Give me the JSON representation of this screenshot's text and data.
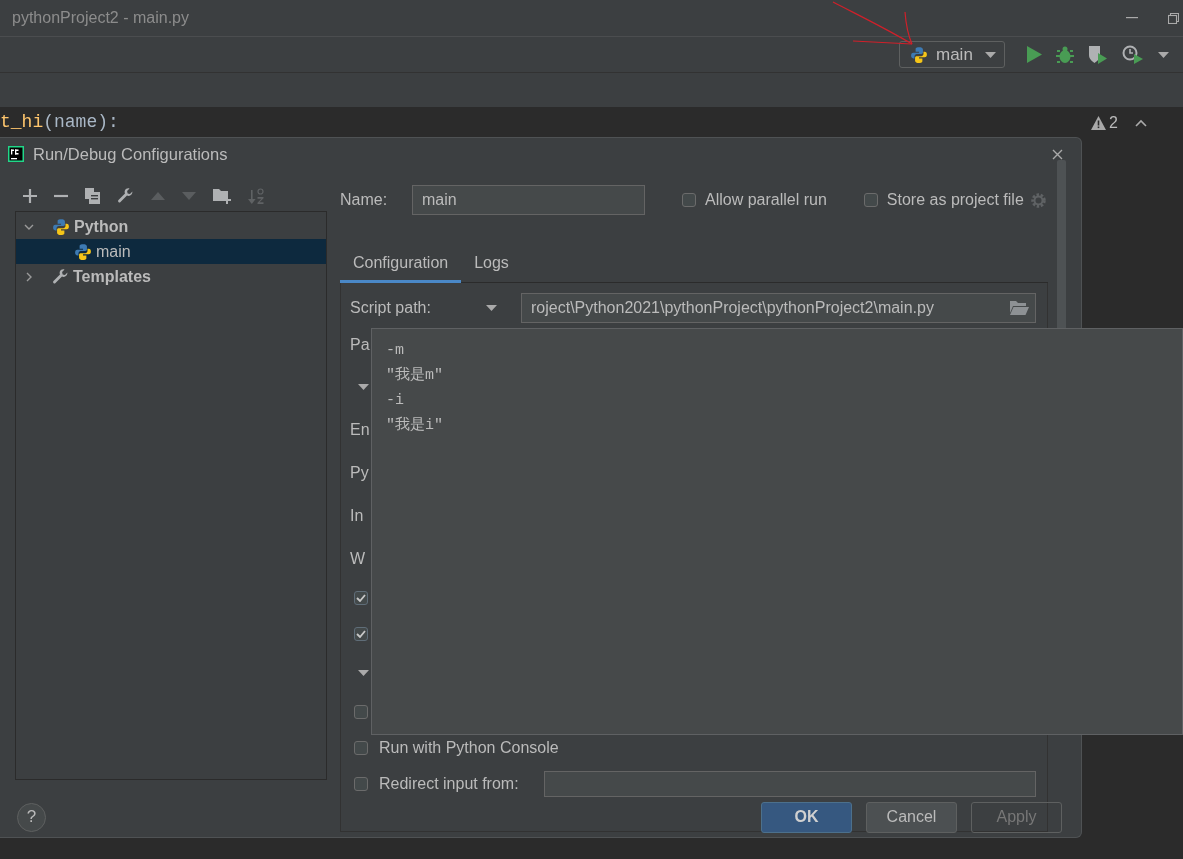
{
  "window": {
    "title": "pythonProject2 - main.py"
  },
  "toolbar": {
    "run_configuration": "main"
  },
  "editor": {
    "code_function": "t_hi",
    "code_rest": "(name):",
    "warning_count": "2"
  },
  "dialog": {
    "title": "Run/Debug Configurations",
    "tree": [
      {
        "label": "Python",
        "kind": "python",
        "expanded": true,
        "selected": false,
        "children": [
          {
            "label": "main",
            "kind": "python",
            "selected": true
          }
        ]
      },
      {
        "label": "Templates",
        "kind": "templates",
        "expanded": false,
        "selected": false
      }
    ],
    "name_field": {
      "label": "Name:",
      "value": "main"
    },
    "options": [
      {
        "label": "Allow parallel run",
        "checked": false
      },
      {
        "label": "Store as project file",
        "checked": false
      }
    ],
    "tabs": [
      {
        "label": "Configuration",
        "selected": true
      },
      {
        "label": "Logs",
        "selected": false
      }
    ],
    "script_path": {
      "label": "Script path:",
      "value": "roject\\Python2021\\pythonProject\\pythonProject2\\main.py"
    },
    "rows": [
      {
        "kind": "label",
        "text": "Pa"
      },
      {
        "kind": "section",
        "expanded": true
      },
      {
        "kind": "label",
        "text": "En"
      },
      {
        "kind": "label",
        "text": "Py"
      },
      {
        "kind": "label",
        "text": "In"
      },
      {
        "kind": "label",
        "text": "W"
      },
      {
        "kind": "checkbox",
        "checked": true
      },
      {
        "kind": "checkbox",
        "checked": true
      },
      {
        "kind": "section",
        "expanded": true
      },
      {
        "kind": "checkbox",
        "checked": false
      },
      {
        "kind": "checkbox",
        "checked": false,
        "text": "Run with Python Console"
      },
      {
        "kind": "checkbox_field",
        "checked": false,
        "text": "Redirect input from:"
      }
    ],
    "help": "?",
    "buttons": [
      {
        "label": "OK",
        "default": true,
        "disabled": false
      },
      {
        "label": "Cancel",
        "default": false,
        "disabled": false
      },
      {
        "label": "Apply",
        "default": false,
        "disabled": true
      }
    ]
  },
  "parameters_popup": {
    "lines": [
      "-m",
      "\"我是m\"",
      "-i",
      "\"我是i\""
    ]
  }
}
